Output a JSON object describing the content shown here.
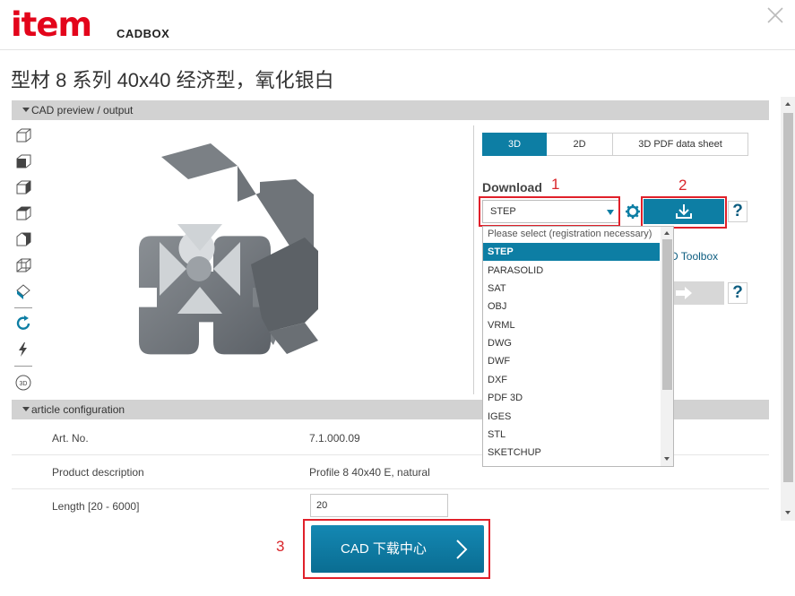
{
  "header": {
    "logo_text": "item",
    "logo_subtext": "CADBOX",
    "brand_color": "#e3051b"
  },
  "page_title": "型材 8 系列 40x40 经济型，氧化银白",
  "sections": {
    "preview_label": "CAD preview / output",
    "config_label": "article configuration"
  },
  "view_tools": [
    "iso-view-icon",
    "front-view-icon",
    "side-view-icon",
    "top-view-icon",
    "shaded-view-icon",
    "wireframe-view-icon",
    "paint-icon",
    "rotate-icon",
    "flash-icon",
    "3d-rotate-icon"
  ],
  "tabs": [
    {
      "label": "3D",
      "active": true
    },
    {
      "label": "2D",
      "active": false
    },
    {
      "label": "3D PDF data sheet",
      "active": false
    }
  ],
  "download": {
    "label": "Download",
    "selected_format": "STEP",
    "toolbox_link": "D Toolbox"
  },
  "dropdown": {
    "hint": "Please select (registration necessary)",
    "options": [
      "STEP",
      "PARASOLID",
      "SAT",
      "OBJ",
      "VRML",
      "DWG",
      "DWF",
      "DXF",
      "PDF 3D",
      "IGES",
      "STL",
      "SKETCHUP"
    ],
    "selected_index": 0
  },
  "annotations": [
    "1",
    "2",
    "3"
  ],
  "config": {
    "art_no_label": "Art. No.",
    "art_no_value": "7.1.000.09",
    "desc_label": "Product description",
    "desc_value": "Profile 8 40x40 E, natural",
    "length_label": "Length [20 - 6000]",
    "length_value": "20"
  },
  "cad_button_label": "CAD 下载中心",
  "colors": {
    "accent": "#0d7ea4",
    "annotation": "#e0202a"
  }
}
